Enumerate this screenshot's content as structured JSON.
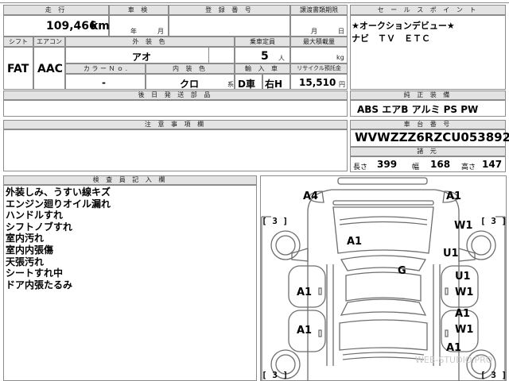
{
  "top_cut_text": "回走行",
  "vehicle": {
    "mileage_header": "走 行",
    "mileage_value": "109,466",
    "mileage_unit": "km",
    "inspection_header": "車 検",
    "inspection_year": "年",
    "inspection_month": "月",
    "registration_header": "登 録 番 号",
    "transfer_header": "譲渡書類期限",
    "transfer_month": "月",
    "transfer_day": "日",
    "shift_header": "シフト",
    "shift_value": "FAT",
    "aircon_header": "エアコン",
    "aircon_value": "AAC",
    "exterior_color_header": "外 装 色",
    "exterior_color_value": "アオ",
    "capacity_header": "乗車定員",
    "capacity_value": "5",
    "capacity_unit": "人",
    "max_load_header": "最大積載量",
    "max_load_unit": "kg",
    "color_no_header": "カ ラ ー Ｎ ｏ .",
    "color_no_value": "-",
    "interior_color_header": "内 装 色",
    "interior_color_value": "クロ",
    "interior_suffix": "系",
    "import_header": "輸 入 車",
    "import_value": "D車",
    "handle_value": "右H",
    "recycle_header": "リサイクル預託金",
    "recycle_value": "15,510",
    "recycle_unit": "円",
    "delivery_header": "後 日 発 送 部 品",
    "notes_header": "注 意 事 項 欄"
  },
  "sales": {
    "header": "セ ー ル ス ポ イ ン ト",
    "line1": "★オークションデビュー★",
    "line2": "ナビ　ＴＶ　ＥＴＣ",
    "equipment_header": "純 正 装 備",
    "equipment_value": "ABS エアB アルミ PS PW",
    "chassis_header": "車 台 番 号",
    "chassis_value": "WVWZZZ6RZCU053892",
    "dims_header": "諸 元",
    "length_label": "長さ",
    "length_value": "399",
    "width_label": "幅",
    "width_value": "168",
    "height_label": "高さ",
    "height_value": "147"
  },
  "inspector": {
    "header": "検 査 員 記 入 欄",
    "remarks": [
      "外装しみ、うすい線キズ",
      "エンジン廻りオイル漏れ",
      "ハンドルすれ",
      "シフトノブすれ",
      "室内汚れ",
      "室内内張傷",
      "天張汚れ",
      "シートすれ中",
      "ドア内張たるみ"
    ]
  },
  "diagram": {
    "marks": [
      "A4",
      "A1",
      "A1",
      "W1",
      "U1",
      "G",
      "U1",
      "W1",
      "A1",
      "A1",
      "A1",
      "W1",
      "A1"
    ],
    "bracket_left_top": "[ 3 ]",
    "bracket_left_bottom": "[ 3 ]",
    "bracket_right_top": "[ 3 ]",
    "bracket_right_bottom": "[ 3 ]",
    "watermark": "WEB-STUDIO.PRO"
  }
}
